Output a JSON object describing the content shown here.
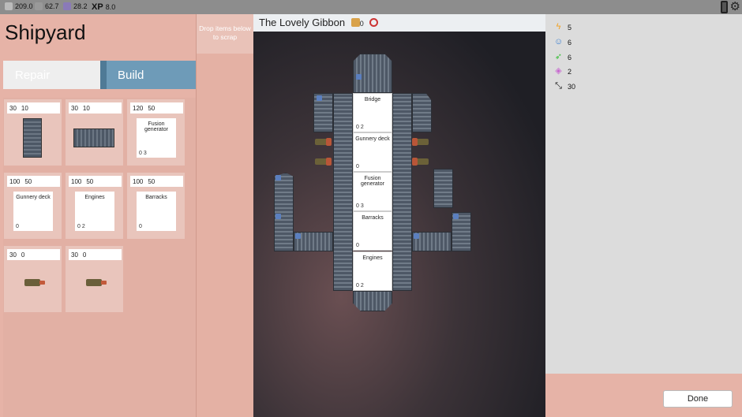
{
  "topbar": {
    "resources": [
      {
        "icon": "scrap-icon",
        "value": "209.0"
      },
      {
        "icon": "bolt-icon",
        "value": "62.7"
      },
      {
        "icon": "crystal-icon",
        "value": "28.2"
      }
    ],
    "xp_label": "XP",
    "xp_value": "8.0"
  },
  "left": {
    "title": "Shipyard",
    "tabs": {
      "repair": "Repair",
      "build": "Build"
    },
    "parts": [
      {
        "cost_a": "30",
        "cost_b": "10",
        "kind": "vertical-hull",
        "label": "",
        "stat_a": "",
        "stat_b": ""
      },
      {
        "cost_a": "30",
        "cost_b": "10",
        "kind": "horizontal-hull",
        "label": "",
        "stat_a": "",
        "stat_b": ""
      },
      {
        "cost_a": "120",
        "cost_b": "50",
        "kind": "room",
        "label": "Fusion generator",
        "stat_a": "0",
        "stat_b": "3"
      },
      {
        "cost_a": "100",
        "cost_b": "50",
        "kind": "room",
        "label": "Gunnery deck",
        "stat_a": "0",
        "stat_b": ""
      },
      {
        "cost_a": "100",
        "cost_b": "50",
        "kind": "room",
        "label": "Engines",
        "stat_a": "0",
        "stat_b": "2"
      },
      {
        "cost_a": "100",
        "cost_b": "50",
        "kind": "room",
        "label": "Barracks",
        "stat_a": "0",
        "stat_b": ""
      },
      {
        "cost_a": "30",
        "cost_b": "0",
        "kind": "gun-left",
        "label": "",
        "stat_a": "",
        "stat_b": ""
      },
      {
        "cost_a": "30",
        "cost_b": "0",
        "kind": "gun-right",
        "label": "",
        "stat_a": "",
        "stat_b": ""
      }
    ]
  },
  "scrap": {
    "label": "Drop items below to scrap"
  },
  "ship": {
    "name": "The Lovely Gibbon",
    "header_count": "0",
    "rooms": [
      {
        "label": "Bridge",
        "stat_a": "0",
        "stat_b": "2"
      },
      {
        "label": "Gunnery deck",
        "stat_a": "0",
        "stat_b": ""
      },
      {
        "label": "Fusion generator",
        "stat_a": "0",
        "stat_b": "3"
      },
      {
        "label": "Barracks",
        "stat_a": "0",
        "stat_b": ""
      },
      {
        "label": "Engines",
        "stat_a": "0",
        "stat_b": "2"
      }
    ]
  },
  "stats": [
    {
      "icon": "bolt-icon",
      "color": "#f2a020",
      "value": "5"
    },
    {
      "icon": "crew-icon",
      "color": "#3a7fd0",
      "value": "6"
    },
    {
      "icon": "rocket-icon",
      "color": "#3bbf3b",
      "value": "6"
    },
    {
      "icon": "shield-icon",
      "color": "#c86ad0",
      "value": "2"
    },
    {
      "icon": "size-icon",
      "color": "#111111",
      "value": "30"
    }
  ],
  "done_label": "Done"
}
